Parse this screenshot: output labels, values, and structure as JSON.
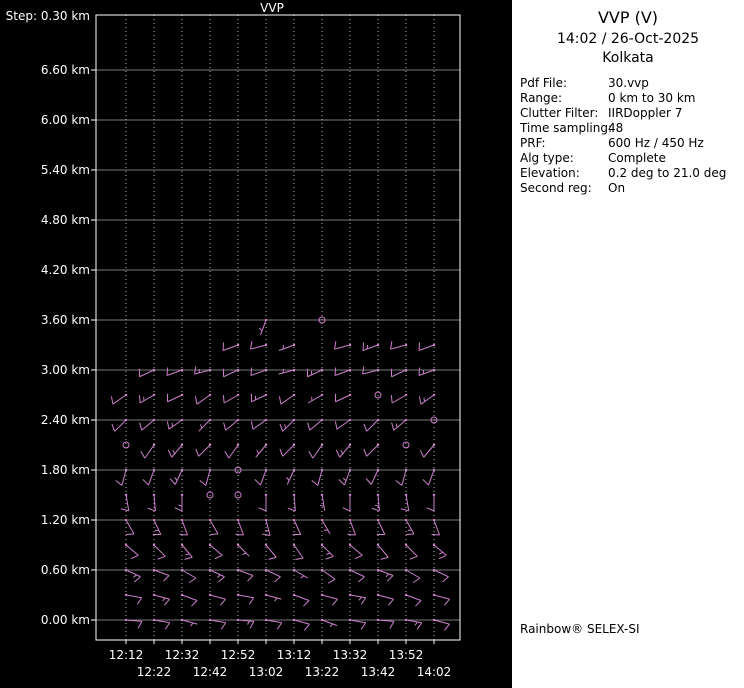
{
  "panel": {
    "title": "VVP (V)",
    "datetime": "14:02 / 26-Oct-2025",
    "site": "Kolkata",
    "fields": [
      {
        "label": "Pdf File:",
        "value": "30.vvp"
      },
      {
        "label": "Range:",
        "value": "0 km to 30 km"
      },
      {
        "label": "Clutter Filter:",
        "value": "IIRDoppler 7"
      },
      {
        "label": "Time sampling:",
        "value": "48"
      },
      {
        "label": "PRF:",
        "value": "600 Hz / 450 Hz"
      },
      {
        "label": "Alg type:",
        "value": "Complete"
      },
      {
        "label": "Elevation:",
        "value": "0.2 deg to 21.0 deg"
      },
      {
        "label": "Second reg:",
        "value": "On"
      }
    ],
    "footer": "Rainbow® SELEX-SI"
  },
  "chart_data": {
    "type": "wind-barb-time-height",
    "title": "VVP",
    "step_label": "Step: 0.30 km",
    "height_step_km": 0.3,
    "time_step_min": 10,
    "y_ticks": [
      {
        "label": "6.60 km",
        "km": 6.6
      },
      {
        "label": "6.00 km",
        "km": 6.0
      },
      {
        "label": "5.40 km",
        "km": 5.4
      },
      {
        "label": "4.80 km",
        "km": 4.8
      },
      {
        "label": "4.20 km",
        "km": 4.2
      },
      {
        "label": "3.60 km",
        "km": 3.6
      },
      {
        "label": "3.00 km",
        "km": 3.0
      },
      {
        "label": "2.40 km",
        "km": 2.4
      },
      {
        "label": "1.80 km",
        "km": 1.8
      },
      {
        "label": "1.20 km",
        "km": 1.2
      },
      {
        "label": "0.60 km",
        "km": 0.6
      },
      {
        "label": "0.00 km",
        "km": 0.0
      }
    ],
    "x_ticks": [
      "12:12",
      "12:22",
      "12:32",
      "12:42",
      "12:52",
      "13:02",
      "13:12",
      "13:22",
      "13:32",
      "13:42",
      "13:52",
      "14:02"
    ],
    "barb_color": "#cc82cc",
    "grid_color": "#c0c0c0",
    "barb_format": "[time_index, height_km, wind_from_deg, speed_kt] ; speed 0 = calm circle",
    "barbs": [
      [
        0,
        0.0,
        95,
        10
      ],
      [
        1,
        0.0,
        100,
        10
      ],
      [
        2,
        0.0,
        105,
        5
      ],
      [
        3,
        0.0,
        100,
        10
      ],
      [
        4,
        0.0,
        95,
        15
      ],
      [
        5,
        0.0,
        100,
        10
      ],
      [
        6,
        0.0,
        105,
        10
      ],
      [
        7,
        0.0,
        110,
        5
      ],
      [
        8,
        0.0,
        100,
        10
      ],
      [
        9,
        0.0,
        95,
        10
      ],
      [
        10,
        0.0,
        100,
        15
      ],
      [
        11,
        0.0,
        105,
        10
      ],
      [
        0,
        0.3,
        100,
        10
      ],
      [
        1,
        0.3,
        105,
        15
      ],
      [
        2,
        0.3,
        110,
        10
      ],
      [
        3,
        0.3,
        105,
        10
      ],
      [
        4,
        0.3,
        100,
        10
      ],
      [
        5,
        0.3,
        105,
        5
      ],
      [
        6,
        0.3,
        110,
        10
      ],
      [
        7,
        0.3,
        105,
        10
      ],
      [
        8,
        0.3,
        100,
        15
      ],
      [
        9,
        0.3,
        105,
        10
      ],
      [
        10,
        0.3,
        110,
        10
      ],
      [
        11,
        0.3,
        105,
        10
      ],
      [
        0,
        0.6,
        115,
        15
      ],
      [
        1,
        0.6,
        110,
        10
      ],
      [
        2,
        0.6,
        120,
        10
      ],
      [
        3,
        0.6,
        115,
        15
      ],
      [
        4,
        0.6,
        110,
        10
      ],
      [
        5,
        0.6,
        115,
        10
      ],
      [
        6,
        0.6,
        120,
        5
      ],
      [
        7,
        0.6,
        125,
        10
      ],
      [
        8,
        0.6,
        115,
        10
      ],
      [
        9,
        0.6,
        110,
        15
      ],
      [
        10,
        0.6,
        120,
        10
      ],
      [
        11,
        0.6,
        115,
        10
      ],
      [
        0,
        0.9,
        130,
        10
      ],
      [
        1,
        0.9,
        135,
        10
      ],
      [
        2,
        0.9,
        140,
        15
      ],
      [
        3,
        0.9,
        130,
        10
      ],
      [
        4,
        0.9,
        135,
        5
      ],
      [
        5,
        0.9,
        140,
        10
      ],
      [
        6,
        0.9,
        145,
        10
      ],
      [
        7,
        0.9,
        135,
        15
      ],
      [
        8,
        0.9,
        130,
        10
      ],
      [
        9,
        0.9,
        140,
        10
      ],
      [
        10,
        0.9,
        135,
        10
      ],
      [
        11,
        0.9,
        130,
        15
      ],
      [
        0,
        1.2,
        150,
        10
      ],
      [
        1,
        1.2,
        155,
        15
      ],
      [
        2,
        1.2,
        160,
        10
      ],
      [
        3,
        1.2,
        150,
        10
      ],
      [
        4,
        1.2,
        160,
        10
      ],
      [
        5,
        1.2,
        165,
        15
      ],
      [
        6,
        1.2,
        155,
        10
      ],
      [
        7,
        1.2,
        150,
        5
      ],
      [
        8,
        1.2,
        160,
        10
      ],
      [
        9,
        1.2,
        155,
        10
      ],
      [
        10,
        1.2,
        150,
        15
      ],
      [
        11,
        1.2,
        160,
        10
      ],
      [
        0,
        1.5,
        170,
        10
      ],
      [
        1,
        1.5,
        175,
        10
      ],
      [
        2,
        1.5,
        180,
        15
      ],
      [
        3,
        1.5,
        0,
        0
      ],
      [
        4,
        1.5,
        0,
        0
      ],
      [
        5,
        1.5,
        180,
        10
      ],
      [
        6,
        1.5,
        175,
        10
      ],
      [
        7,
        1.5,
        170,
        5
      ],
      [
        8,
        1.5,
        180,
        10
      ],
      [
        9,
        1.5,
        175,
        15
      ],
      [
        10,
        1.5,
        170,
        10
      ],
      [
        11,
        1.5,
        180,
        10
      ],
      [
        0,
        1.8,
        195,
        10
      ],
      [
        1,
        1.8,
        200,
        10
      ],
      [
        2,
        1.8,
        205,
        15
      ],
      [
        3,
        1.8,
        195,
        10
      ],
      [
        4,
        1.8,
        0,
        0
      ],
      [
        5,
        1.8,
        200,
        10
      ],
      [
        6,
        1.8,
        205,
        5
      ],
      [
        7,
        1.8,
        195,
        10
      ],
      [
        8,
        1.8,
        200,
        15
      ],
      [
        9,
        1.8,
        205,
        10
      ],
      [
        10,
        1.8,
        195,
        10
      ],
      [
        11,
        1.8,
        200,
        10
      ],
      [
        0,
        2.1,
        0,
        0
      ],
      [
        1,
        2.1,
        215,
        10
      ],
      [
        2,
        2.1,
        220,
        15
      ],
      [
        3,
        2.1,
        225,
        10
      ],
      [
        4,
        2.1,
        215,
        10
      ],
      [
        5,
        2.1,
        220,
        5
      ],
      [
        6,
        2.1,
        225,
        10
      ],
      [
        7,
        2.1,
        215,
        10
      ],
      [
        8,
        2.1,
        220,
        15
      ],
      [
        9,
        2.1,
        225,
        10
      ],
      [
        10,
        2.1,
        0,
        0
      ],
      [
        11,
        2.1,
        220,
        10
      ],
      [
        0,
        2.4,
        225,
        10
      ],
      [
        1,
        2.4,
        230,
        10
      ],
      [
        2,
        2.4,
        235,
        15
      ],
      [
        3,
        2.4,
        225,
        5
      ],
      [
        4,
        2.4,
        230,
        10
      ],
      [
        5,
        2.4,
        235,
        10
      ],
      [
        6,
        2.4,
        225,
        15
      ],
      [
        7,
        2.4,
        230,
        10
      ],
      [
        8,
        2.4,
        235,
        10
      ],
      [
        9,
        2.4,
        225,
        10
      ],
      [
        10,
        2.4,
        230,
        15
      ],
      [
        11,
        2.4,
        0,
        0
      ],
      [
        0,
        2.7,
        235,
        10
      ],
      [
        1,
        2.7,
        240,
        15
      ],
      [
        2,
        2.7,
        245,
        10
      ],
      [
        3,
        2.7,
        235,
        10
      ],
      [
        4,
        2.7,
        240,
        10
      ],
      [
        5,
        2.7,
        245,
        15
      ],
      [
        6,
        2.7,
        235,
        10
      ],
      [
        7,
        2.7,
        240,
        5
      ],
      [
        8,
        2.7,
        245,
        10
      ],
      [
        9,
        2.7,
        0,
        0
      ],
      [
        10,
        2.7,
        240,
        10
      ],
      [
        11,
        2.7,
        235,
        15
      ],
      [
        1,
        3.0,
        245,
        10
      ],
      [
        2,
        3.0,
        250,
        10
      ],
      [
        3,
        3.0,
        255,
        15
      ],
      [
        4,
        3.0,
        245,
        10
      ],
      [
        5,
        3.0,
        250,
        10
      ],
      [
        6,
        3.0,
        255,
        5
      ],
      [
        7,
        3.0,
        245,
        15
      ],
      [
        8,
        3.0,
        250,
        10
      ],
      [
        9,
        3.0,
        255,
        10
      ],
      [
        10,
        3.0,
        245,
        10
      ],
      [
        11,
        3.0,
        250,
        15
      ],
      [
        4,
        3.3,
        250,
        10
      ],
      [
        5,
        3.3,
        255,
        10
      ],
      [
        6,
        3.3,
        250,
        5
      ],
      [
        8,
        3.3,
        255,
        10
      ],
      [
        9,
        3.3,
        250,
        15
      ],
      [
        10,
        3.3,
        255,
        10
      ],
      [
        11,
        3.3,
        250,
        10
      ],
      [
        5,
        3.6,
        200,
        5
      ],
      [
        7,
        3.6,
        0,
        0
      ]
    ]
  }
}
